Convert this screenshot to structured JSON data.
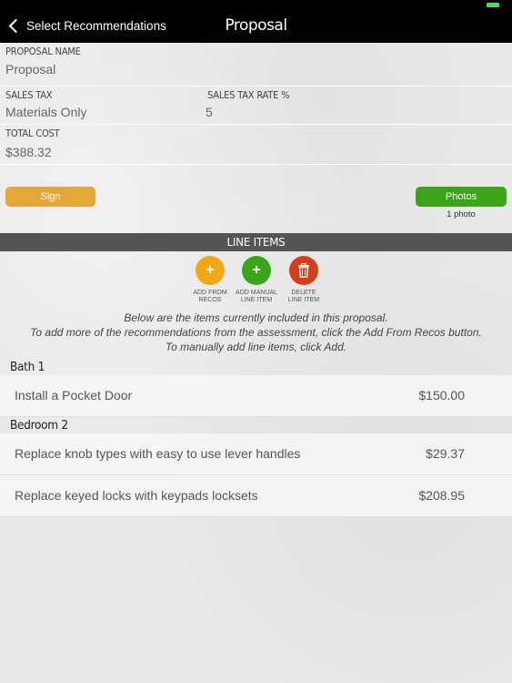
{
  "nav": {
    "back_label": "Select Recommendations",
    "title": "Proposal"
  },
  "fields": {
    "proposal_name_label": "PROPOSAL NAME",
    "proposal_name_value": "Proposal",
    "sales_tax_label": "SALES TAX",
    "sales_tax_value": "Materials Only",
    "sales_tax_rate_label": "SALES TAX RATE %",
    "sales_tax_rate_value": "5",
    "total_cost_label": "TOTAL COST",
    "total_cost_value": "$388.32"
  },
  "buttons": {
    "sign": "Sign",
    "photos": "Photos",
    "photo_count": "1 photo"
  },
  "line_items": {
    "header": "LINE ITEMS",
    "actions": [
      {
        "line1": "ADD FROM",
        "line2": "RECOS",
        "color": "#f0a817"
      },
      {
        "line1": "ADD MANUAL",
        "line2": "LINE ITEM",
        "color": "#3aa51b"
      },
      {
        "line1": "DELETE",
        "line2": "LINE ITEM",
        "color": "#d53e1d"
      }
    ],
    "instructions": [
      "Below are the items currently included in this proposal.",
      "To add more of the recommendations from the assessment, click the Add From Recos button.",
      "To manually add line items, click Add."
    ],
    "groups": [
      {
        "name": "Bath 1",
        "items": [
          {
            "description": "Install a Pocket Door",
            "price": "$150.00"
          }
        ]
      },
      {
        "name": "Bedroom 2",
        "items": [
          {
            "description": "Replace knob types with easy to use lever handles",
            "price": "$29.37"
          },
          {
            "description": "Replace keyed locks with keypads locksets",
            "price": "$208.95"
          }
        ]
      }
    ]
  },
  "colors": {
    "nav_bg": "#000000",
    "sign_button": "#e4a83a",
    "photos_button": "#3aa51b",
    "section_header_bg": "#555555",
    "battery": "#4cd964"
  }
}
